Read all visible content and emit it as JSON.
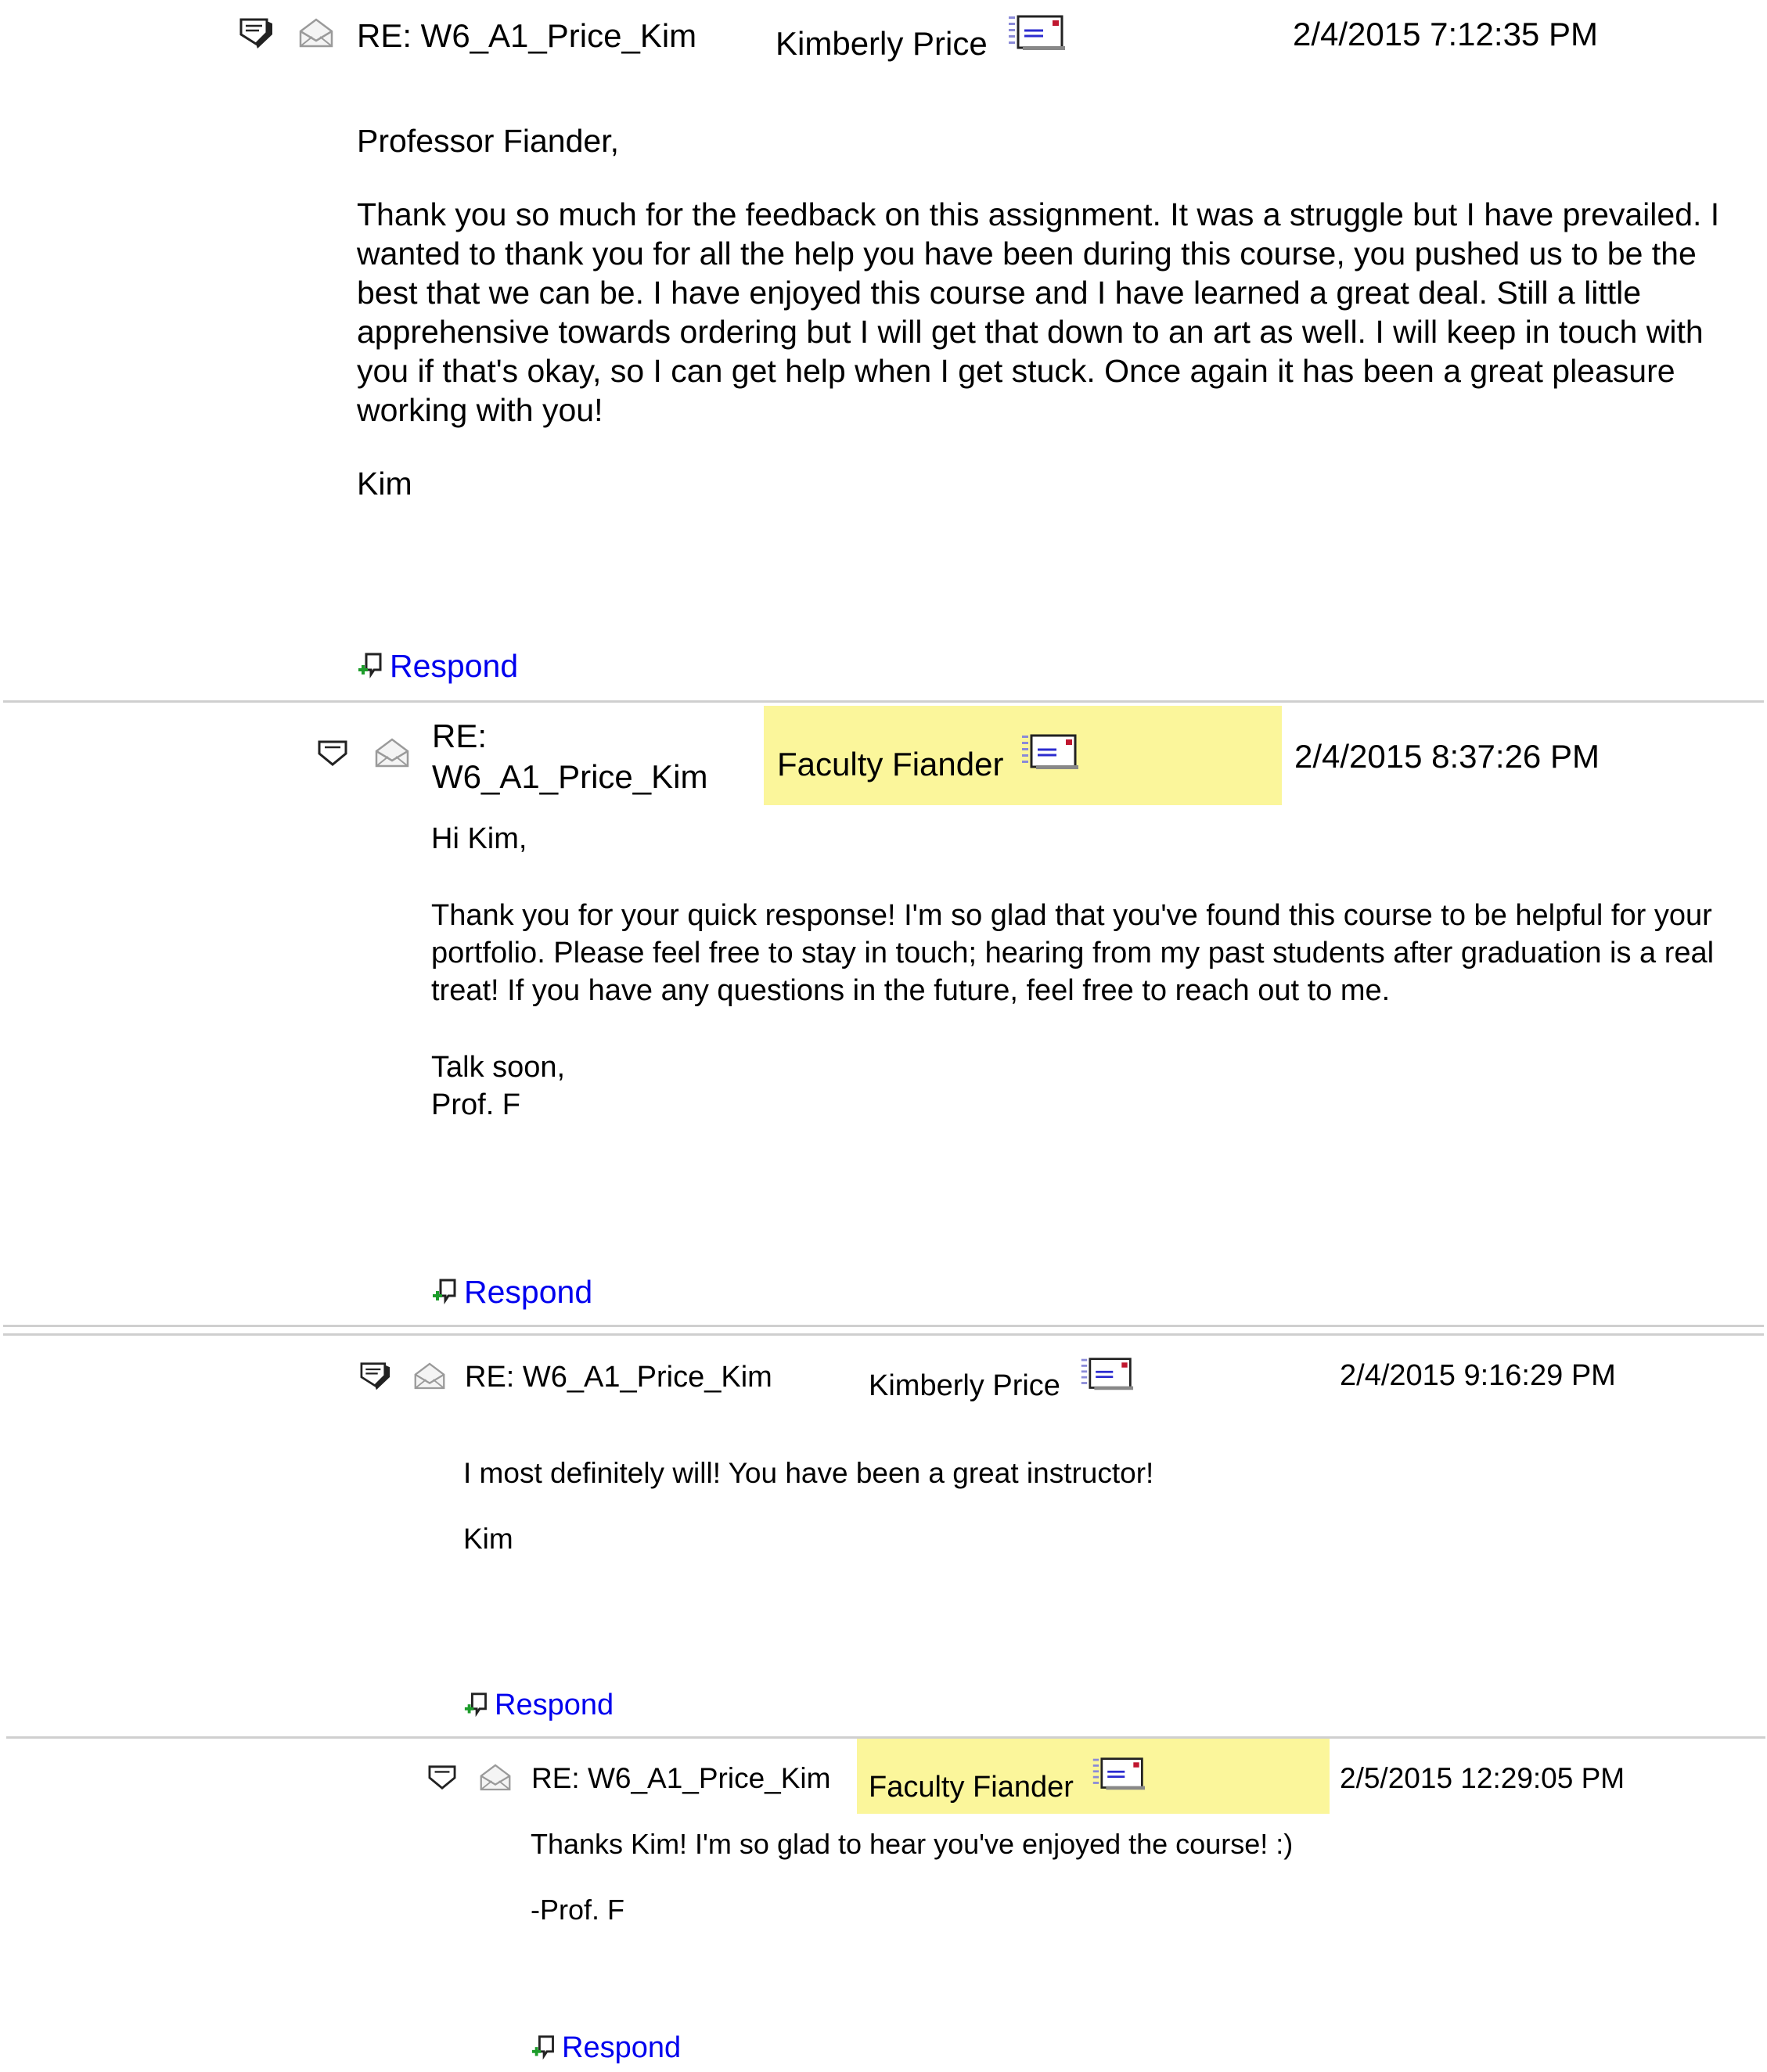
{
  "posts": [
    {
      "subject": "RE: W6_A1_Price_Kim",
      "author": "Kimberly Price",
      "date": "2/4/2015 7:12:35 PM",
      "body": [
        "Professor Fiander,",
        "Thank you so much for the feedback on this assignment. It was a struggle but I have prevailed. I wanted to thank you for all the help you have been during this course, you pushed us to be the best that we can be. I have enjoyed this course and I have learned a great deal. Still a little apprehensive towards ordering but I will get that down to an art as well. I will keep in touch with you if that's okay, so I can get help when I get stuck. Once again it has been a great pleasure working with you!",
        "Kim"
      ],
      "respond_label": "Respond",
      "highlighted": false
    },
    {
      "subject": "RE:\nW6_A1_Price_Kim",
      "author": "Faculty Fiander",
      "date": "2/4/2015 8:37:26 PM",
      "body": [
        "Hi Kim,",
        "Thank you for your quick response! I'm so glad that you've found this course to be helpful for your portfolio.  Please feel free to stay in touch; hearing from my past students after graduation is a real treat!  If you have any questions in the future, feel free to reach out to me.",
        "Talk soon,",
        "Prof. F"
      ],
      "respond_label": "Respond",
      "highlighted": true,
      "highlight_color": "#fbf69b"
    },
    {
      "subject": "RE: W6_A1_Price_Kim",
      "author": "Kimberly Price",
      "date": "2/4/2015 9:16:29 PM",
      "body": [
        "I most definitely will! You have been a great instructor!",
        "Kim"
      ],
      "respond_label": "Respond",
      "highlighted": false
    },
    {
      "subject": "RE: W6_A1_Price_Kim",
      "author": "Faculty Fiander",
      "date": "2/5/2015 12:29:05 PM",
      "body": [
        "Thanks Kim! I'm so glad to hear you've enjoyed the course! :)",
        "-Prof. F"
      ],
      "respond_label": "Respond",
      "highlighted": true,
      "highlight_color": "#fbf69b"
    }
  ],
  "icons": {
    "collapse": "collapse-thread-icon",
    "envelope": "read-envelope-icon",
    "mail": "send-email-icon",
    "respond": "respond-add-icon"
  },
  "colors": {
    "link": "#0000ee",
    "divider": "#cfcfcf",
    "highlight": "#fbf69b"
  }
}
